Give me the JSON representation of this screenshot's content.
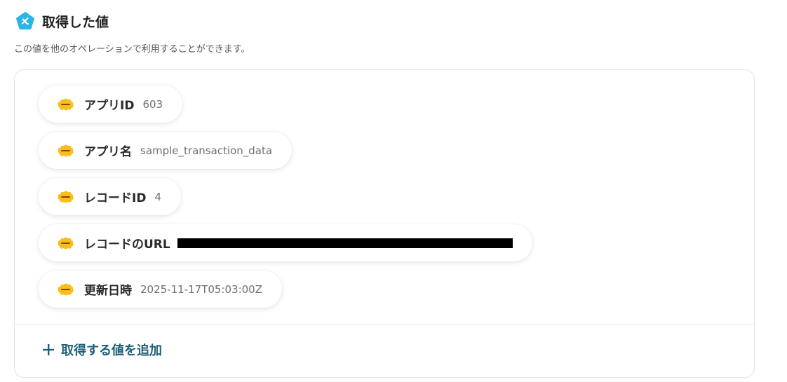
{
  "header": {
    "title": "取得した値",
    "subtitle": "この値を他のオペレーションで利用することができます。"
  },
  "colors": {
    "accent": "#29b6e6",
    "logo": "#fbbd18",
    "add_button": "#1f5f7a"
  },
  "values": [
    {
      "label": "アプリID",
      "value": "603",
      "icon": "kintone-logo-icon"
    },
    {
      "label": "アプリ名",
      "value": "sample_transaction_data",
      "icon": "kintone-logo-icon"
    },
    {
      "label": "レコードID",
      "value": "4",
      "icon": "kintone-logo-icon"
    },
    {
      "label": "レコードのURL",
      "value": "",
      "redacted": true,
      "icon": "kintone-logo-icon"
    },
    {
      "label": "更新日時",
      "value": "2025-11-17T05:03:00Z",
      "icon": "kintone-logo-icon"
    }
  ],
  "add_button": {
    "label": "取得する値を追加",
    "icon": "plus-icon"
  }
}
